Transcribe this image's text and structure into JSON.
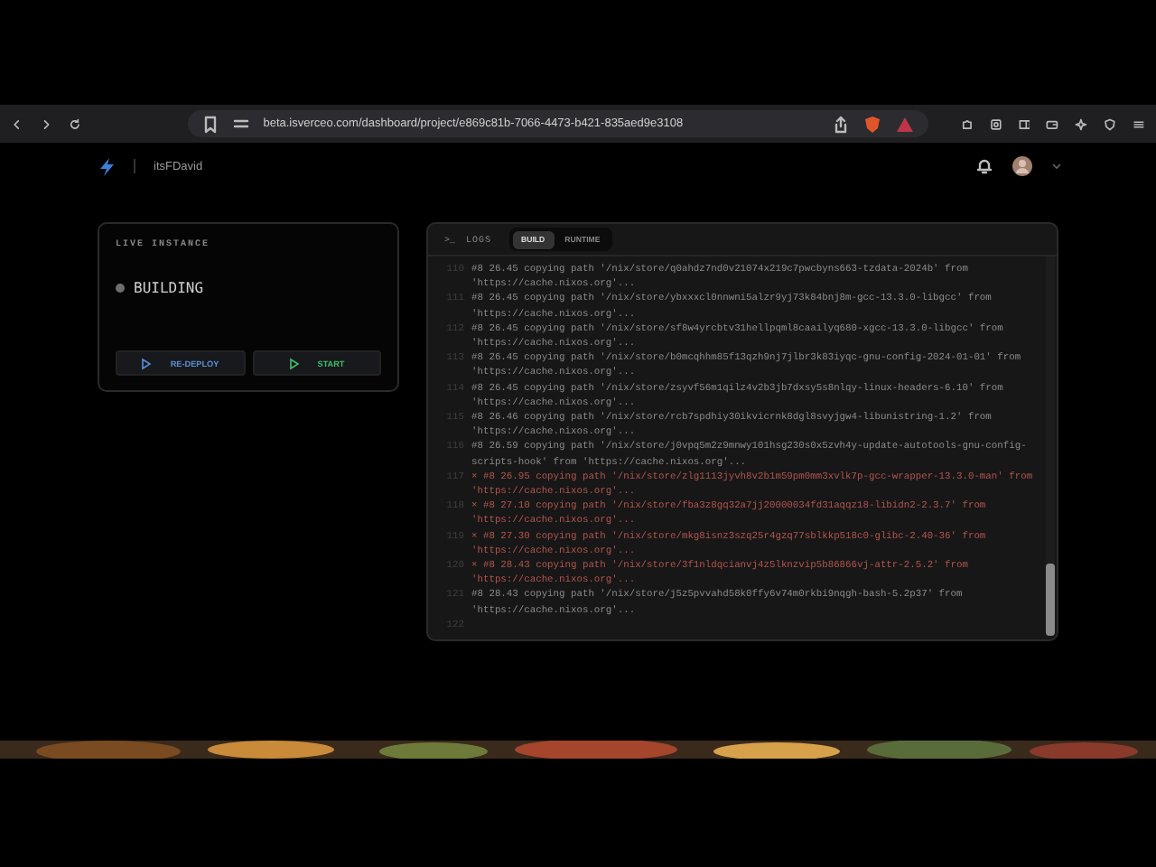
{
  "browser": {
    "url": "beta.isverceo.com/dashboard/project/e869c81b-7066-4473-b421-835aed9e3108"
  },
  "header": {
    "user": "itsFDavid"
  },
  "instance": {
    "title": "LIVE INSTANCE",
    "status": "BUILDING",
    "color": "#6e6e6e",
    "buttons": [
      {
        "label": "RE-DEPLOY",
        "color": "#5b8fd6"
      },
      {
        "label": "START",
        "color": "#3fbf6a"
      }
    ]
  },
  "logs": {
    "title": "LOGS",
    "prompt": ">_",
    "tabs": [
      {
        "label": "BUILD",
        "selected": true
      },
      {
        "label": "RUNTIME",
        "selected": false
      }
    ],
    "entries": [
      {
        "number": "110",
        "error": false,
        "lines": [
          "#8 26.45 copying path '/nix/store/q0ahdz7nd0v21074x219c7pwcbyns663-tzdata-2024b' from",
          "'https://cache.nixos.org'..."
        ]
      },
      {
        "number": "111",
        "error": false,
        "lines": [
          "#8 26.45 copying path '/nix/store/ybxxxcl0nnwni5alzr9yj73k84bnj8m-gcc-13.3.0-libgcc' from",
          "'https://cache.nixos.org'..."
        ]
      },
      {
        "number": "112",
        "error": false,
        "lines": [
          "#8 26.45 copying path '/nix/store/sf8w4yrcbtv31hellpqml8caailyq680-xgcc-13.3.0-libgcc' from",
          "'https://cache.nixos.org'..."
        ]
      },
      {
        "number": "113",
        "error": false,
        "lines": [
          "#8 26.45 copying path '/nix/store/b0mcqhhm85f13qzh9nj7jlbr3k83iyqc-gnu-config-2024-01-01' from",
          "'https://cache.nixos.org'..."
        ]
      },
      {
        "number": "114",
        "error": false,
        "lines": [
          "#8 26.45 copying path '/nix/store/zsyvf56m1qilz4v2b3jb7dxsy5s8nlqy-linux-headers-6.10' from",
          "'https://cache.nixos.org'..."
        ]
      },
      {
        "number": "115",
        "error": false,
        "lines": [
          "#8 26.46 copying path '/nix/store/rcb7spdhiy30ikvicrnk8dgl8svyjgw4-libunistring-1.2' from",
          "'https://cache.nixos.org'..."
        ]
      },
      {
        "number": "116",
        "error": false,
        "lines": [
          "#8 26.59 copying path '/nix/store/j0vpq5m2z9mnwy101hsg230s0x5zvh4y-update-autotools-gnu-config-",
          "scripts-hook' from 'https://cache.nixos.org'..."
        ]
      },
      {
        "number": "117",
        "error": true,
        "lines": [
          "× #8 26.95 copying path '/nix/store/zlg1113jyvh8v2b1m59pm0mm3xvlk7p-gcc-wrapper-13.3.0-man' from",
          "'https://cache.nixos.org'..."
        ]
      },
      {
        "number": "118",
        "error": true,
        "lines": [
          "× #8 27.10 copying path '/nix/store/fba3z8gq32a7jj20000034fd31aqqz18-libidn2-2.3.7' from",
          "'https://cache.nixos.org'..."
        ]
      },
      {
        "number": "119",
        "error": true,
        "lines": [
          "× #8 27.30 copying path '/nix/store/mkg8isnz3szq25r4gzq77sblkkp518c0-glibc-2.40-36' from",
          "'https://cache.nixos.org'..."
        ]
      },
      {
        "number": "120",
        "error": true,
        "lines": [
          "× #8 28.43 copying path '/nix/store/3f1nldqcianvj4z5lknzvip5b86866vj-attr-2.5.2' from",
          "'https://cache.nixos.org'..."
        ]
      },
      {
        "number": "121",
        "error": false,
        "lines": [
          "#8 28.43 copying path '/nix/store/j5z5pvvahd58k0ffy6v74m0rkbi9nqgh-bash-5.2p37' from",
          "'https://cache.nixos.org'..."
        ]
      },
      {
        "number": "122"
      }
    ]
  }
}
